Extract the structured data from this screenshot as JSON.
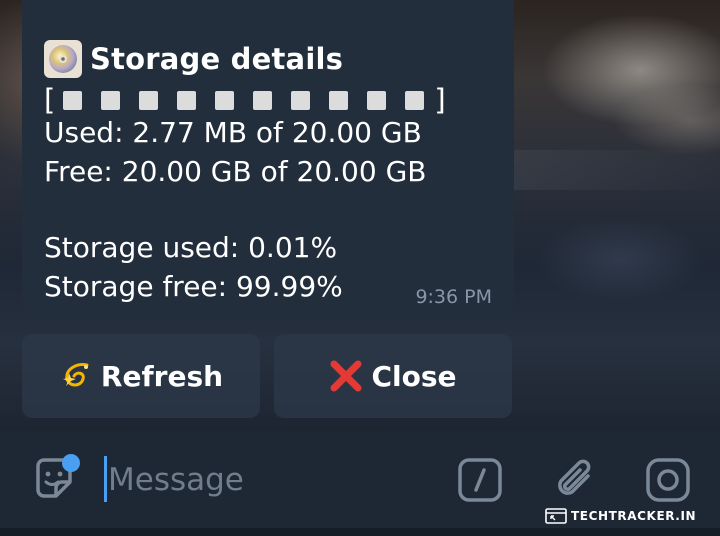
{
  "message": {
    "title": "Storage details",
    "title_icon": "optical-disc-icon",
    "bar_open": "[",
    "bar_close": "]",
    "bar_cells": 10,
    "used_line": "Used: 2.77 MB of 20.00 GB",
    "free_line": "Free: 20.00 GB of 20.00 GB",
    "storage_used_line": "Storage used: 0.01%",
    "storage_free_line": "Storage free: 99.99%",
    "time": "9:36 PM"
  },
  "keyboard": {
    "refresh_label": "Refresh",
    "refresh_icon": "dizzy-star-icon",
    "close_label": "Close",
    "close_icon": "cross-mark-icon"
  },
  "input_bar": {
    "placeholder": "Message",
    "left_icon": "sticker-icon",
    "right_icons": [
      "commands-slash-icon",
      "attach-paperclip-icon",
      "camera-icon"
    ]
  },
  "colors": {
    "bubble": "#222e3c",
    "input_bar": "#1e2835",
    "accent": "#4a9ff0",
    "timestamp": "#8a96a6",
    "close_red": "#e53935"
  },
  "watermark": {
    "text": "TECHTRACKER.IN"
  }
}
